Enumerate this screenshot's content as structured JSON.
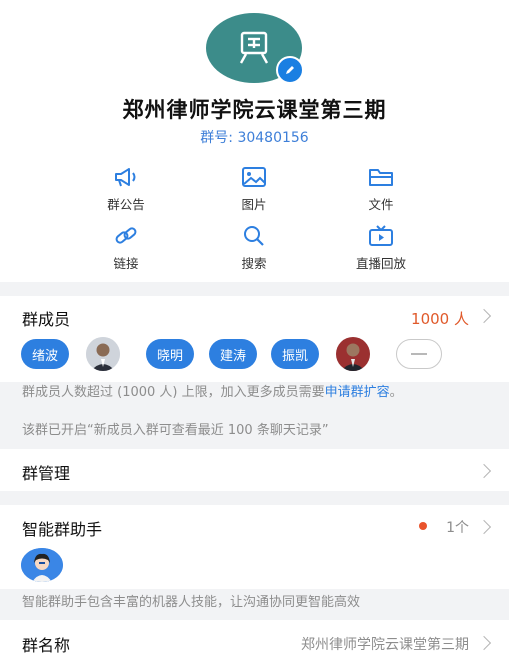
{
  "group": {
    "title": "郑州律师学院云课堂第三期",
    "number_label": "群号: 30480156"
  },
  "actions": [
    {
      "label": "群公告",
      "icon": "megaphone-icon"
    },
    {
      "label": "图片",
      "icon": "image-icon"
    },
    {
      "label": "文件",
      "icon": "folder-icon"
    },
    {
      "label": "链接",
      "icon": "link-icon"
    },
    {
      "label": "搜索",
      "icon": "search-icon"
    },
    {
      "label": "直播回放",
      "icon": "tv-icon"
    }
  ],
  "members": {
    "title": "群成员",
    "count": "1000 人",
    "chips": [
      "绪波",
      "晓明",
      "建涛",
      "振凯"
    ],
    "notice_line1": "群成员人数超过 (1000 人) 上限，加入更多成员需要",
    "notice_link": "申请群扩容",
    "notice_end": "。",
    "notice_line3": "该群已开启“新成员入群可查看最近 100 条聊天记录”"
  },
  "management": {
    "title": "群管理"
  },
  "assistant": {
    "title": "智能群助手",
    "count": "1个",
    "description": "智能群助手包含丰富的机器人技能，让沟通协同更智能高效"
  },
  "group_name": {
    "title": "群名称",
    "value": "郑州律师学院云课堂第三期"
  },
  "colors": {
    "accent": "#2d7fe0",
    "count": "#e05a2b",
    "avatar_bg": "#3c8c8a"
  }
}
